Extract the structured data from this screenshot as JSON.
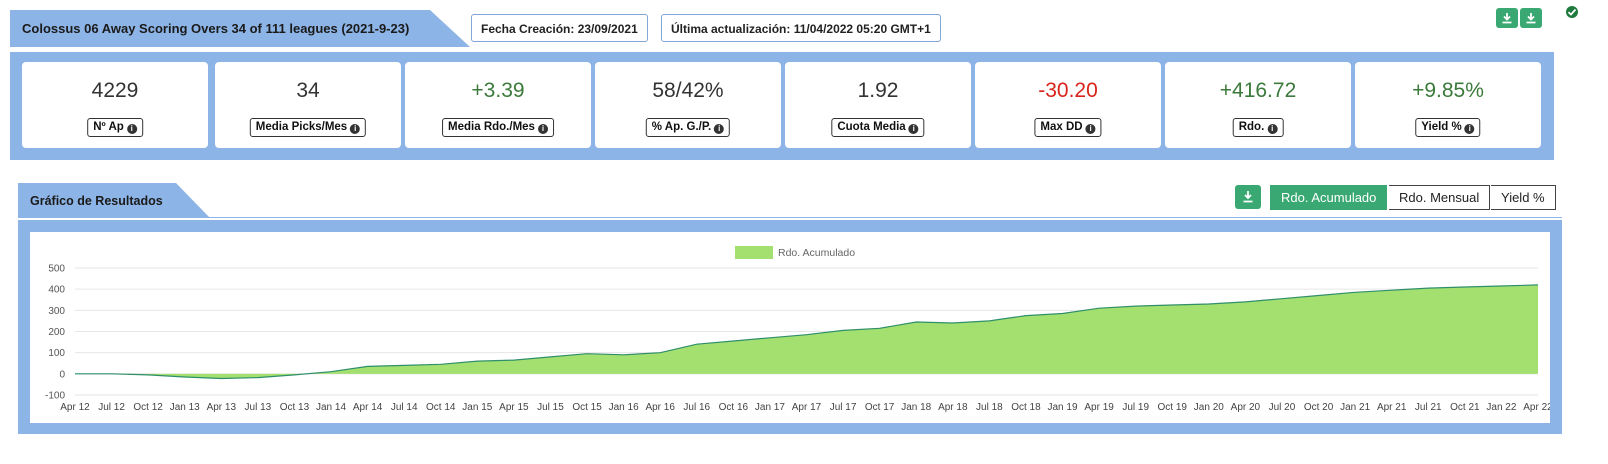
{
  "header": {
    "title": "Colossus 06 Away Scoring Overs 34 of 111 leagues (2021-9-23)",
    "created": "Fecha Creación: 23/09/2021",
    "updated": "Última actualización: 11/04/2022 05:20 GMT+1"
  },
  "kpis": [
    {
      "value": "4229",
      "label": "Nº Ap",
      "tone": "neutral"
    },
    {
      "value": "34",
      "label": "Media Picks/Mes",
      "tone": "neutral"
    },
    {
      "value": "+3.39",
      "label": "Media Rdo./Mes",
      "tone": "pos"
    },
    {
      "value": "58/42%",
      "label": "% Ap. G./P.",
      "tone": "neutral"
    },
    {
      "value": "1.92",
      "label": "Cuota Media",
      "tone": "neutral"
    },
    {
      "value": "-30.20",
      "label": "Max DD",
      "tone": "neg"
    },
    {
      "value": "+416.72",
      "label": "Rdo.",
      "tone": "pos"
    },
    {
      "value": "+9.85%",
      "label": "Yield %",
      "tone": "pos"
    }
  ],
  "chart_section": {
    "title": "Gráfico de Resultados",
    "toggles": [
      "Rdo. Acumulado",
      "Rdo. Mensual",
      "Yield %"
    ],
    "active_toggle": 0
  },
  "colors": {
    "accent": "#3aa872",
    "band": "#8db4e6",
    "area_fill": "#a3e070",
    "area_line": "#2f8f6a",
    "positive": "#3b7a3b",
    "negative": "#d9241c"
  },
  "chart_data": {
    "type": "area",
    "series": [
      {
        "name": "Rdo. Acumulado"
      }
    ],
    "legend": "top-center",
    "ylim": [
      -100,
      500
    ],
    "yticks": [
      -100,
      0,
      100,
      200,
      300,
      400,
      500
    ],
    "xticks": [
      "Apr 12",
      "Jul 12",
      "Oct 12",
      "Jan 13",
      "Apr 13",
      "Jul 13",
      "Oct 13",
      "Jan 14",
      "Apr 14",
      "Jul 14",
      "Oct 14",
      "Jan 15",
      "Apr 15",
      "Jul 15",
      "Oct 15",
      "Jan 16",
      "Apr 16",
      "Jul 16",
      "Oct 16",
      "Jan 17",
      "Apr 17",
      "Jul 17",
      "Oct 17",
      "Jan 18",
      "Apr 18",
      "Jul 18",
      "Oct 18",
      "Jan 19",
      "Apr 19",
      "Jul 19",
      "Oct 19",
      "Jan 20",
      "Apr 20",
      "Jul 20",
      "Oct 20",
      "Jan 21",
      "Apr 21",
      "Jul 21",
      "Oct 21",
      "Jan 22",
      "Apr 22"
    ],
    "x": [
      "Apr 12",
      "Jul 12",
      "Oct 12",
      "Jan 13",
      "Apr 13",
      "Jul 13",
      "Oct 13",
      "Jan 14",
      "Apr 14",
      "Jul 14",
      "Oct 14",
      "Jan 15",
      "Apr 15",
      "Jul 15",
      "Oct 15",
      "Jan 16",
      "Apr 16",
      "Jul 16",
      "Oct 16",
      "Jan 17",
      "Apr 17",
      "Jul 17",
      "Oct 17",
      "Jan 18",
      "Apr 18",
      "Jul 18",
      "Oct 18",
      "Jan 19",
      "Apr 19",
      "Jul 19",
      "Oct 19",
      "Jan 20",
      "Apr 20",
      "Jul 20",
      "Oct 20",
      "Jan 21",
      "Apr 21",
      "Jul 21",
      "Oct 21",
      "Jan 22",
      "Apr 22"
    ],
    "values": [
      0,
      0,
      -5,
      -15,
      -22,
      -18,
      -5,
      10,
      35,
      40,
      45,
      60,
      65,
      80,
      95,
      90,
      100,
      140,
      155,
      170,
      185,
      205,
      215,
      245,
      240,
      250,
      275,
      285,
      310,
      320,
      325,
      330,
      340,
      355,
      370,
      385,
      395,
      405,
      410,
      415,
      420
    ],
    "grid": true
  }
}
